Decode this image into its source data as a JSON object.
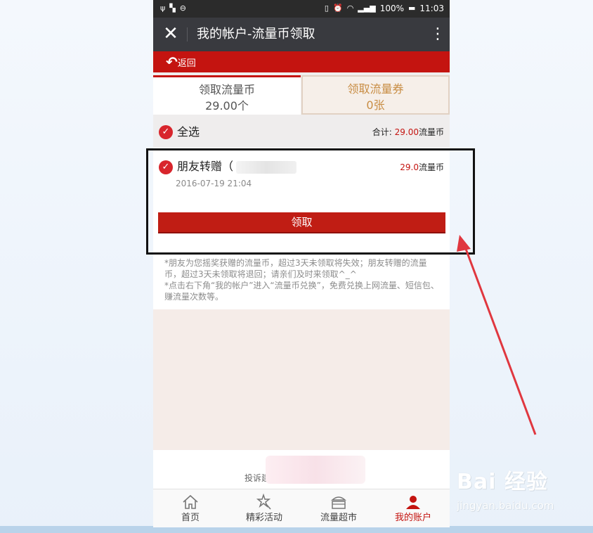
{
  "status_bar": {
    "battery_percent": "100%",
    "time": "11:03"
  },
  "nav": {
    "title": "我的帐户-流量币领取"
  },
  "back": {
    "label": "返回"
  },
  "tabs": [
    {
      "label": "领取流量币",
      "count": "29.00个"
    },
    {
      "label": "领取流量券",
      "count": "0张"
    }
  ],
  "select_all": {
    "label": "全选",
    "total_prefix": "合计:",
    "total_value": "29.00",
    "total_unit": "流量币"
  },
  "item": {
    "title": "朋友转赠（",
    "amount_value": "29.0",
    "amount_unit": "流量币",
    "date": "2016-07-19 21:04"
  },
  "claim_button": {
    "label": "领取"
  },
  "notes": [
    "*朋友为您摇奖获赠的流量币，超过3天未领取将失效；朋友转赠的流量币，超过3天未领取将退回；请亲们及时来领取^_^",
    "*点击右下角“我的帐户”进入“流量币兑换”，免费兑换上网流量、短信包、赚流量次数等。"
  ],
  "footer": {
    "link_text": "投诉建"
  },
  "tabbar": [
    {
      "label": "首页",
      "icon": "home-icon",
      "active": false
    },
    {
      "label": "精彩活动",
      "icon": "wand-icon",
      "active": false
    },
    {
      "label": "流量超市",
      "icon": "market-icon",
      "active": false
    },
    {
      "label": "我的账户",
      "icon": "user-icon",
      "active": true
    }
  ],
  "watermark": {
    "brand": "Bai 经验",
    "url": "jingyan.baidu.com"
  },
  "colors": {
    "accent_red": "#c41410",
    "nav_dark": "#393a3f",
    "status_dark": "#2b2b2b"
  }
}
